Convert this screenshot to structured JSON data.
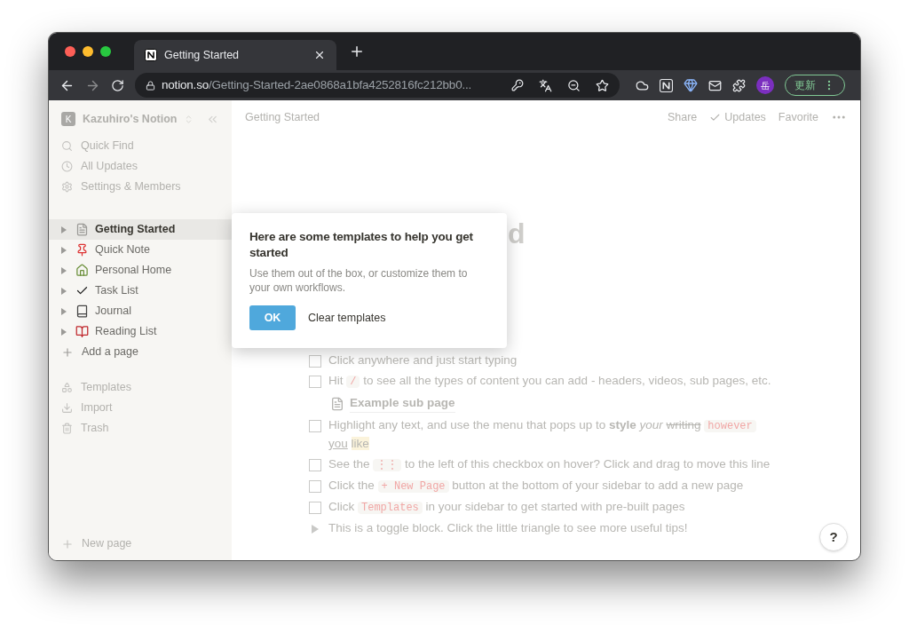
{
  "browser": {
    "tab": {
      "title": "Getting Started",
      "selected": true
    },
    "url_host": "notion.so",
    "url_path": "/Getting-Started-2ae0868a1bfa4252816fc212bb0...",
    "avatar": "岳",
    "update_button": "更新"
  },
  "sidebar": {
    "workspace_initial": "K",
    "workspace": "Kazuhiro's Notion",
    "top_items": [
      {
        "label": "Quick Find"
      },
      {
        "label": "All Updates"
      },
      {
        "label": "Settings & Members"
      }
    ],
    "pages": [
      {
        "label": "Getting Started",
        "selected": true
      },
      {
        "label": "Quick Note",
        "selected": false
      },
      {
        "label": "Personal Home",
        "selected": false
      },
      {
        "label": "Task List",
        "selected": false
      },
      {
        "label": "Journal",
        "selected": false
      },
      {
        "label": "Reading List",
        "selected": false
      }
    ],
    "add_page": "Add a page",
    "bottom_items": [
      {
        "label": "Templates"
      },
      {
        "label": "Import"
      },
      {
        "label": "Trash"
      }
    ],
    "new_page": "New page"
  },
  "topbar": {
    "breadcrumb": "Getting Started",
    "actions": [
      "Share",
      "Updates",
      "Favorite"
    ]
  },
  "heading_visible": "d",
  "popup": {
    "title": "Here are some templates to help you get started",
    "body": "Use them out of the box, or customize them to your own workflows.",
    "ok": "OK",
    "clear": "Clear templates"
  },
  "blocks": [
    {
      "kind": "todo",
      "checked": false,
      "segments": [
        {
          "kind": "text",
          "text": "Click anywhere and just start typing"
        }
      ]
    },
    {
      "kind": "todo",
      "checked": false,
      "segments": [
        {
          "kind": "text",
          "text": "Hit "
        },
        {
          "kind": "code",
          "text": "/"
        },
        {
          "kind": "text",
          "text": " to see all the types of content you can add - headers, videos, sub pages, etc."
        }
      ]
    },
    {
      "kind": "subpage",
      "segments": [
        {
          "kind": "text",
          "text": "Example sub page"
        }
      ]
    },
    {
      "kind": "todo",
      "checked": false,
      "segments": [
        {
          "kind": "text",
          "text": "Highlight any text, and use the menu that pops up to "
        },
        {
          "kind": "bold",
          "text": "style"
        },
        {
          "kind": "italic",
          "text": "your"
        },
        {
          "kind": "strike",
          "text": "writing"
        },
        {
          "kind": "code",
          "text": "however"
        },
        {
          "kind": "underline",
          "text": "you"
        },
        {
          "kind": "highlight",
          "text": "like"
        }
      ]
    },
    {
      "kind": "todo",
      "checked": false,
      "segments": [
        {
          "kind": "text",
          "text": "See the "
        },
        {
          "kind": "code",
          "text": "⋮⋮"
        },
        {
          "kind": "text",
          "text": " to the left of this checkbox on hover? Click and drag to move this line"
        }
      ]
    },
    {
      "kind": "todo",
      "checked": false,
      "segments": [
        {
          "kind": "text",
          "text": "Click the "
        },
        {
          "kind": "code",
          "text": "+ New Page"
        },
        {
          "kind": "text",
          "text": " button at the bottom of your sidebar to add a new page"
        }
      ]
    },
    {
      "kind": "todo",
      "checked": false,
      "segments": [
        {
          "kind": "text",
          "text": "Click "
        },
        {
          "kind": "code",
          "text": "Templates"
        },
        {
          "kind": "text",
          "text": " in your sidebar to get started with pre-built pages"
        }
      ]
    },
    {
      "kind": "toggle",
      "segments": [
        {
          "kind": "text",
          "text": "This is a toggle block. Click the little triangle to see more useful tips!"
        }
      ]
    }
  ],
  "help": "?"
}
